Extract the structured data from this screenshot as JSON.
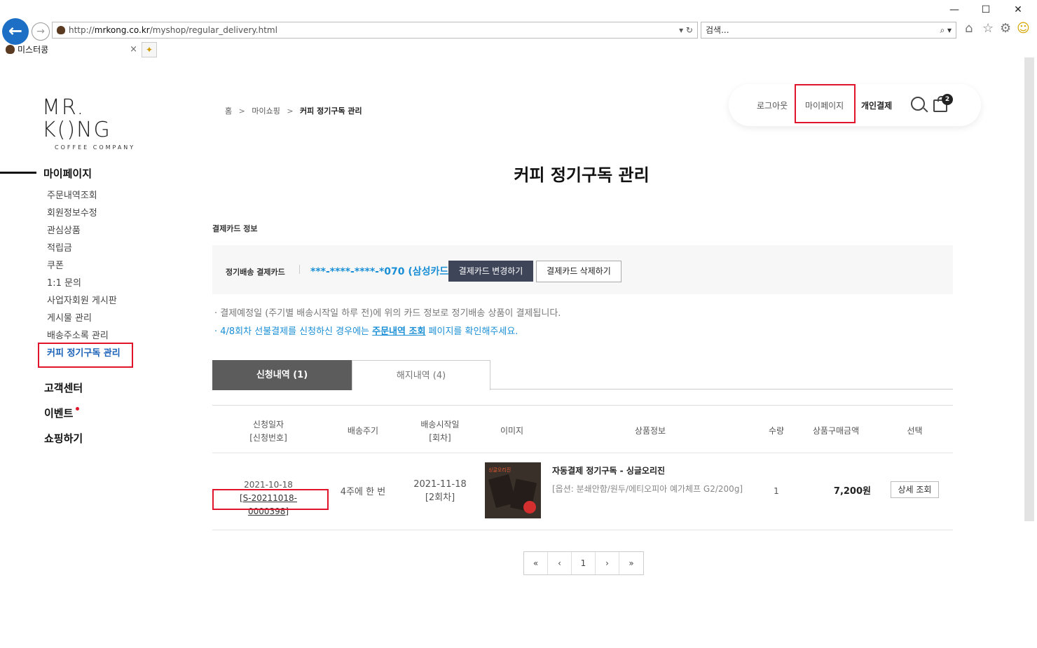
{
  "browser": {
    "url_prefix": "http://",
    "url_host": "mrkong.co.kr",
    "url_path": "/myshop/regular_delivery.html",
    "url_tail": "▾ ↻",
    "search_placeholder": "검색...",
    "search_tail": "⌕ ▾",
    "tab_title": "미스터콩",
    "tab_close": "×",
    "win_min": "—",
    "win_max": "☐",
    "win_close": "✕",
    "back_glyph": "←",
    "fwd_glyph": "→",
    "new_tab_glyph": "✦",
    "home_glyph": "⌂",
    "star_glyph": "☆",
    "gear_glyph": "⚙",
    "smile_glyph": "☺"
  },
  "logo": {
    "main": "MR. K()NG",
    "sub": "COFFEE COMPANY"
  },
  "breadcrumb": {
    "home": "홈",
    "sep": ">",
    "level2": "마이쇼핑",
    "current": "커피 정기구독 관리"
  },
  "topnav": {
    "logout": "로그아웃",
    "mypage": "마이페이지",
    "personal_payment": "개인결제",
    "cart_count": "2"
  },
  "sidebar": {
    "title": "마이페이지",
    "items": [
      "주문내역조회",
      "회원정보수정",
      "관심상품",
      "적립금",
      "쿠폰",
      "1:1 문의",
      "사업자회원 게시판",
      "게시물 관리",
      "배송주소록 관리",
      "커피 정기구독 관리"
    ],
    "active_index": 9,
    "customer_center": "고객센터",
    "event": "이벤트",
    "shopping": "쇼핑하기"
  },
  "page_title": "커피 정기구독 관리",
  "card": {
    "section_title": "결제카드 정보",
    "label": "정기배송 결제카드",
    "number": "***-****-****-*070 (삼성카드)",
    "change_btn": "결제카드 변경하기",
    "delete_btn": "결제카드 삭제하기"
  },
  "notes": {
    "line1": "· 결제예정일 (주기별 배송시작일 하루 전)에 위의 카드 정보로 정기배송 상품이 결제됩니다.",
    "line2_prefix": "· 4/8회차 선불결제를 신청하신 경우에는 ",
    "line2_link": "주문내역 조회",
    "line2_suffix": " 페이지를 확인해주세요."
  },
  "tabs": {
    "applied": "신청내역 (1)",
    "cancelled": "해지내역 (4)"
  },
  "table": {
    "headers": {
      "apply_date": "신청일자",
      "apply_no": "[신청번호]",
      "cycle": "배송주기",
      "start_date": "배송시작일",
      "round": "[회차]",
      "image": "이미지",
      "product": "상품정보",
      "qty": "수량",
      "amount": "상품구매금액",
      "select": "선택"
    },
    "rows": [
      {
        "apply_date": "2021-10-18",
        "apply_no": "[S-20211018-0000398]",
        "cycle": "4주에 한 번",
        "start_date": "2021-11-18",
        "round": "[2회차]",
        "product_name": "자동결제 정기구독 - 싱글오리진",
        "product_option": "[옵션: 분쇄안함/원두/에티오피아 예가체프 G2/200g]",
        "image_tag": "싱글오리진",
        "qty": "1",
        "amount": "7,200원",
        "action": "상세 조회"
      }
    ]
  },
  "pager": {
    "first": "«",
    "prev": "‹",
    "page": "1",
    "next": "›",
    "last": "»"
  },
  "colors": {
    "highlight": "#e0152b",
    "accent_blue": "#1a8fd6",
    "active_nav": "#1a62b8",
    "dark_button": "#3e4558"
  }
}
